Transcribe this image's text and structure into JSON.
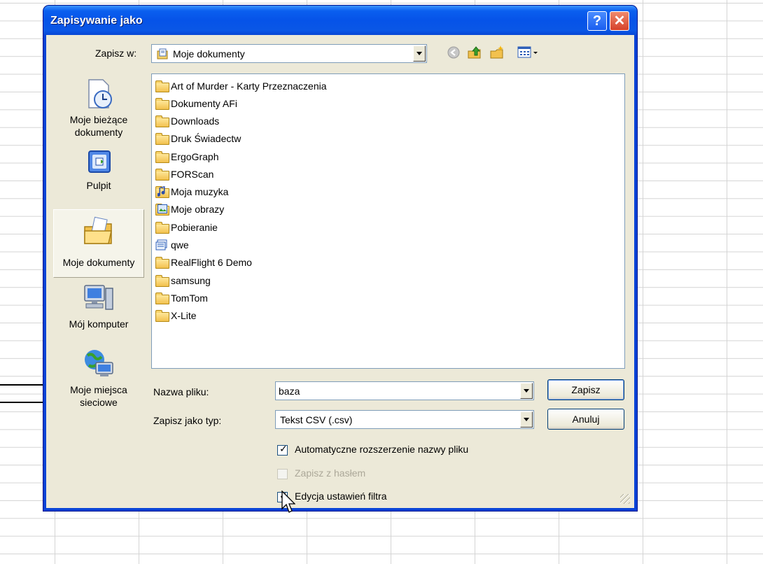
{
  "dialog": {
    "title": "Zapisywanie jako",
    "help_button": "?",
    "close_button": "✕"
  },
  "save_in": {
    "label": "Zapisz w:",
    "value": "Moje dokumenty"
  },
  "toolbar": {
    "icons": [
      "back-icon",
      "up-folder-icon",
      "new-folder-icon",
      "views-menu-icon"
    ]
  },
  "places": [
    {
      "label": "Moje bieżące dokumenty",
      "icon": "recent-documents-icon"
    },
    {
      "label": "Pulpit",
      "icon": "desktop-icon"
    },
    {
      "label": "Moje dokumenty",
      "icon": "my-documents-icon",
      "active": true
    },
    {
      "label": "Mój komputer",
      "icon": "my-computer-icon"
    },
    {
      "label": "Moje miejsca sieciowe",
      "icon": "network-places-icon"
    }
  ],
  "files": [
    {
      "name": "Art of Murder - Karty Przeznaczenia",
      "type": "folder"
    },
    {
      "name": "Dokumenty AFi",
      "type": "folder"
    },
    {
      "name": "Downloads",
      "type": "folder"
    },
    {
      "name": "Druk Świadectw",
      "type": "folder"
    },
    {
      "name": "ErgoGraph",
      "type": "folder"
    },
    {
      "name": "FORScan",
      "type": "folder"
    },
    {
      "name": "Moja muzyka",
      "type": "music-folder"
    },
    {
      "name": "Moje obrazy",
      "type": "pictures-folder"
    },
    {
      "name": "Pobieranie",
      "type": "folder"
    },
    {
      "name": "qwe",
      "type": "file"
    },
    {
      "name": "RealFlight 6 Demo",
      "type": "folder"
    },
    {
      "name": "samsung",
      "type": "folder"
    },
    {
      "name": "TomTom",
      "type": "folder"
    },
    {
      "name": "X-Lite",
      "type": "folder"
    }
  ],
  "filename": {
    "label": "Nazwa pliku:",
    "value": "baza"
  },
  "filetype": {
    "label": "Zapisz jako typ:",
    "value": "Tekst CSV (.csv)"
  },
  "buttons": {
    "save": "Zapisz",
    "cancel": "Anuluj"
  },
  "options": [
    {
      "label": "Automatyczne rozszerzenie nazwy pliku",
      "checked": true,
      "enabled": true
    },
    {
      "label": "Zapisz z hasłem",
      "checked": false,
      "enabled": false
    },
    {
      "label": "Edycja ustawień filtra",
      "checked": true,
      "enabled": true
    }
  ],
  "colors": {
    "title_bar": "#0a5fef",
    "dialog_face": "#ece9d8",
    "disabled_text": "#aca899"
  }
}
